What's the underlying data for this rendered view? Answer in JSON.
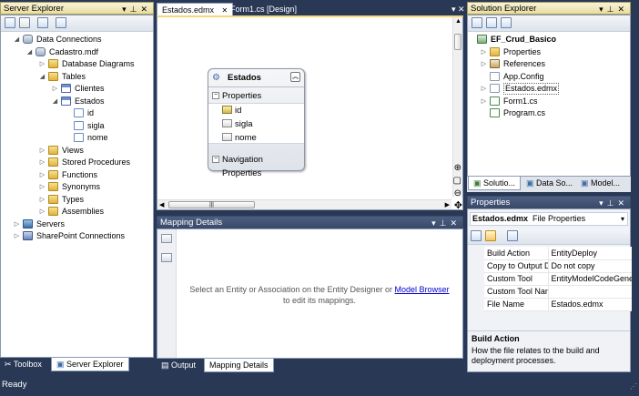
{
  "server_explorer": {
    "title": "Server Explorer",
    "pin": "▾ ▫ ✕",
    "nodes": [
      {
        "label": "Data Connections",
        "icon": "db",
        "indent": 0,
        "expander": "◢"
      },
      {
        "label": "Cadastro.mdf",
        "icon": "db",
        "indent": 1,
        "expander": "◢"
      },
      {
        "label": "Database Diagrams",
        "icon": "folder",
        "indent": 2,
        "expander": "▷"
      },
      {
        "label": "Tables",
        "icon": "folder",
        "indent": 2,
        "expander": "◢"
      },
      {
        "label": "Clientes",
        "icon": "tbl",
        "indent": 3,
        "expander": "▷"
      },
      {
        "label": "Estados",
        "icon": "tbl",
        "indent": 3,
        "expander": "◢"
      },
      {
        "label": "id",
        "icon": "col",
        "indent": 4,
        "expander": ""
      },
      {
        "label": "sigla",
        "icon": "col",
        "indent": 4,
        "expander": ""
      },
      {
        "label": "nome",
        "icon": "col",
        "indent": 4,
        "expander": ""
      },
      {
        "label": "Views",
        "icon": "folder",
        "indent": 2,
        "expander": "▷"
      },
      {
        "label": "Stored Procedures",
        "icon": "folder",
        "indent": 2,
        "expander": "▷"
      },
      {
        "label": "Functions",
        "icon": "folder",
        "indent": 2,
        "expander": "▷"
      },
      {
        "label": "Synonyms",
        "icon": "folder",
        "indent": 2,
        "expander": "▷"
      },
      {
        "label": "Types",
        "icon": "folder",
        "indent": 2,
        "expander": "▷"
      },
      {
        "label": "Assemblies",
        "icon": "folder",
        "indent": 2,
        "expander": "▷"
      },
      {
        "label": "Servers",
        "icon": "srv",
        "indent": 0,
        "expander": "▷"
      },
      {
        "label": "SharePoint Connections",
        "icon": "sp",
        "indent": 0,
        "expander": "▷"
      }
    ]
  },
  "left_bottom_tabs": [
    {
      "label": "Toolbox",
      "icon": "toolbox-icon"
    },
    {
      "label": "Server Explorer",
      "icon": "server-explorer-icon"
    }
  ],
  "doc_tabs": [
    {
      "label": "Estados.edmx",
      "active": true,
      "close": "✕"
    },
    {
      "label": "Form1.cs [Design]",
      "active": false
    }
  ],
  "entity": {
    "title": "Estados",
    "section_properties": "Properties",
    "properties": [
      "id",
      "sigla",
      "nome"
    ],
    "section_navigation": "Navigation Properties"
  },
  "mapping": {
    "title": "Mapping Details",
    "message_prefix": "Select an Entity or Association on the Entity Designer or ",
    "link": "Model Browser",
    "message_suffix": "to edit its mappings."
  },
  "center_bottom_tabs": [
    {
      "label": "Output",
      "active": false
    },
    {
      "label": "Mapping Details",
      "active": true
    }
  ],
  "solution_explorer": {
    "title": "Solution Explorer",
    "nodes": [
      {
        "label": "EF_Crud_Basico",
        "icon": "proj",
        "indent": 0,
        "expander": "",
        "bold": true
      },
      {
        "label": "Properties",
        "icon": "folder",
        "indent": 1,
        "expander": "▷"
      },
      {
        "label": "References",
        "icon": "ref",
        "indent": 1,
        "expander": "▷"
      },
      {
        "label": "App.Config",
        "icon": "file",
        "indent": 1,
        "expander": ""
      },
      {
        "label": "Estados.edmx",
        "icon": "file",
        "indent": 1,
        "expander": "▷",
        "selected": true
      },
      {
        "label": "Form1.cs",
        "icon": "cs",
        "indent": 1,
        "expander": "▷"
      },
      {
        "label": "Program.cs",
        "icon": "cs",
        "indent": 1,
        "expander": ""
      }
    ],
    "tabs": [
      "Solutio...",
      "Data So...",
      "Model..."
    ]
  },
  "properties": {
    "title": "Properties",
    "object_name": "Estados.edmx",
    "object_type": "File Properties",
    "rows": [
      {
        "name": "Build Action",
        "value": "EntityDeploy"
      },
      {
        "name": "Copy to Output D",
        "value": "Do not copy"
      },
      {
        "name": "Custom Tool",
        "value": "EntityModelCodeGene"
      },
      {
        "name": "Custom Tool Nan",
        "value": ""
      },
      {
        "name": "File Name",
        "value": "Estados.edmx"
      }
    ],
    "desc_title": "Build Action",
    "desc_text": "How the file relates to the build and deployment processes."
  },
  "status": {
    "text": "Ready"
  },
  "colors": {
    "chrome": "#293955",
    "accent": "#f8e18f",
    "link": "#0000cc"
  }
}
